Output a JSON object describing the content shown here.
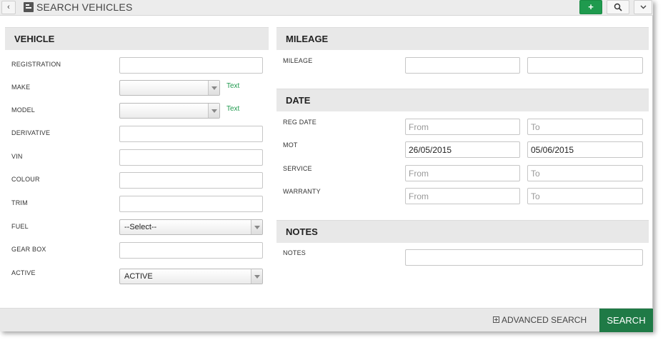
{
  "titlebar": {
    "back_label": "‹",
    "title": "SEARCH VEHICLES",
    "add_label": "+",
    "search_icon": "magnifier",
    "menu_label": "⌄"
  },
  "vehicle": {
    "header": "VEHICLE",
    "registration_label": "REGISTRATION",
    "make_label": "MAKE",
    "make_value": "",
    "make_text_link": "Text",
    "model_label": "MODEL",
    "model_value": "",
    "model_text_link": "Text",
    "derivative_label": "DERIVATIVE",
    "vin_label": "VIN",
    "colour_label": "COLOUR",
    "trim_label": "TRIM",
    "fuel_label": "FUEL",
    "fuel_value": "--Select--",
    "gearbox_label": "GEAR BOX",
    "active_label": "ACTIVE",
    "active_value": "ACTIVE"
  },
  "mileage": {
    "header": "MILEAGE",
    "label": "MILEAGE"
  },
  "date": {
    "header": "DATE",
    "reg_date_label": "REG DATE",
    "mot_label": "MOT",
    "mot_from": "26/05/2015",
    "mot_to": "05/06/2015",
    "service_label": "SERVICE",
    "warranty_label": "WARRANTY",
    "from_placeholder": "From",
    "to_placeholder": "To"
  },
  "notes": {
    "header": "NOTES",
    "label": "NOTES"
  },
  "footer": {
    "advanced_search_label": "ADVANCED SEARCH",
    "search_label": "SEARCH"
  },
  "colors": {
    "accent_green": "#1f9a4e",
    "search_button": "#1f7a46"
  }
}
